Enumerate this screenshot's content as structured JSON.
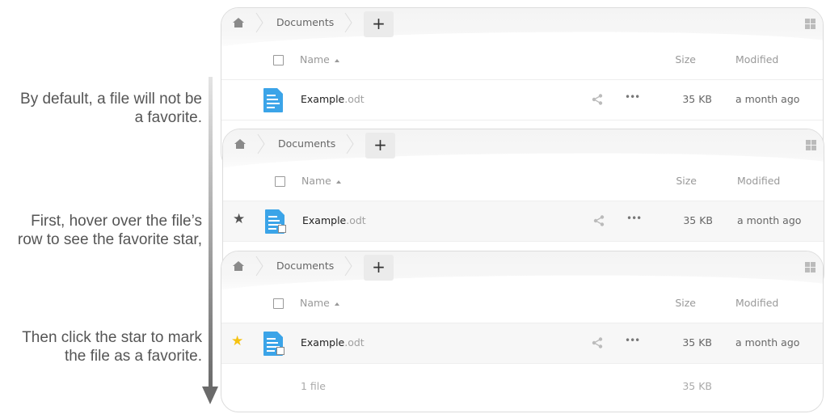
{
  "captions": [
    {
      "line1": "By default, a file will not be",
      "line2": "a favorite."
    },
    {
      "line1": "First, hover over the file’s",
      "line2": "row to see the favorite star,"
    },
    {
      "line1": "Then click the star to mark",
      "line2": "the file as a favorite."
    }
  ],
  "panels": [
    {
      "breadcrumb": "Documents",
      "new_button": "+",
      "columns": {
        "name": "Name",
        "size": "Size",
        "modified": "Modified"
      },
      "file": {
        "name": "Example",
        "ext": ".odt",
        "size": "35 KB",
        "modified": "a month ago",
        "favorite_state": "none",
        "more": "•••"
      }
    },
    {
      "breadcrumb": "Documents",
      "new_button": "+",
      "columns": {
        "name": "Name",
        "size": "Size",
        "modified": "Modified"
      },
      "file": {
        "name": "Example",
        "ext": ".odt",
        "size": "35 KB",
        "modified": "a month ago",
        "favorite_state": "hover",
        "star": "★",
        "more": "•••"
      }
    },
    {
      "breadcrumb": "Documents",
      "new_button": "+",
      "columns": {
        "name": "Name",
        "size": "Size",
        "modified": "Modified"
      },
      "file": {
        "name": "Example",
        "ext": ".odt",
        "size": "35 KB",
        "modified": "a month ago",
        "favorite_state": "favorited",
        "star": "★",
        "more": "•••"
      },
      "summary": {
        "count": "1 file",
        "size": "35 KB"
      }
    }
  ],
  "colors": {
    "file_icon": "#3ba4e8",
    "star_hover": "#555555",
    "star_favorite": "#f5c211",
    "caption_text": "#555555"
  }
}
